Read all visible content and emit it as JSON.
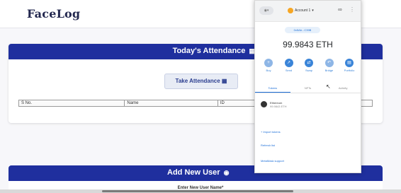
{
  "app": {
    "brand": "FaceLog"
  },
  "attendance": {
    "title": "Today's Attendance",
    "take_button": "Take Attendance",
    "columns": [
      "S No.",
      "Name",
      "ID"
    ]
  },
  "add_user": {
    "title": "Add New User",
    "subtitle": "Enter New User Name*"
  },
  "metamask": {
    "account": "Account 1",
    "address": "0x5Ab...C39B",
    "balance": "99.9843 ETH",
    "actions": [
      {
        "label": "Buy",
        "icon": "plus-icon"
      },
      {
        "label": "Send",
        "icon": "arrow-up-right-icon"
      },
      {
        "label": "Swap",
        "icon": "swap-icon"
      },
      {
        "label": "Bridge",
        "icon": "bridge-icon"
      },
      {
        "label": "Portfolio",
        "icon": "chart-icon"
      }
    ],
    "tabs": [
      "Tokens",
      "NFTs",
      "Activity"
    ],
    "active_tab": "Tokens",
    "asset": {
      "name": "Ethereum",
      "amount": "99.9843 ETH"
    },
    "links": {
      "import": "+ Import tokens",
      "refresh": "Refresh list",
      "support": "MetaMask support"
    }
  },
  "colors": {
    "header_blue": "#1f2f9e",
    "metamask_blue": "#1d6fd8",
    "account_avatar": "#f6a623"
  }
}
